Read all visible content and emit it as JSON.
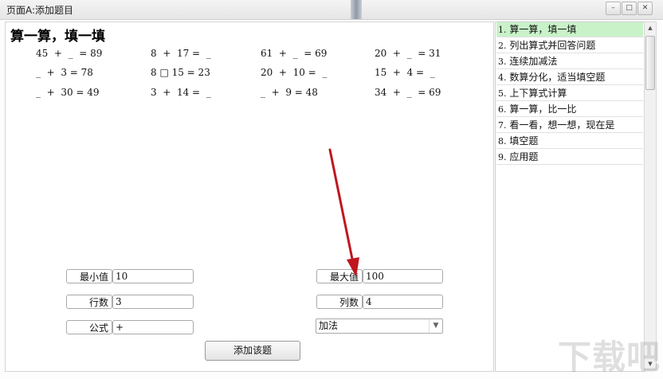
{
  "window": {
    "title": "页面A:添加题目",
    "controls": [
      "–",
      "□",
      "✕"
    ]
  },
  "main": {
    "heading": "算一算，填一填",
    "equations": [
      [
        "45  +  _  = 89",
        "8  +  17 =  _",
        "61  +  _  = 69",
        "20  +  _  = 31"
      ],
      [
        "_  +  3 = 78",
        "8 □ 15 = 23",
        "20  +  10 =  _",
        "15  +  4 =  _"
      ],
      [
        "_  +  30 = 49",
        "3  +  14 =  _",
        "_  +  9 = 48",
        "34  +  _  = 69"
      ]
    ]
  },
  "form": {
    "min_label": "最小值",
    "min_value": "10",
    "max_label": "最大值",
    "max_value": "100",
    "rows_label": "行数",
    "rows_value": "3",
    "cols_label": "列数",
    "cols_value": "4",
    "formula_label": "公式",
    "formula_value": "+",
    "operation_select": "加法",
    "add_button": "添加该题"
  },
  "sidebar": {
    "items": [
      {
        "num": "1.",
        "label": "算一算，填一填"
      },
      {
        "num": "2.",
        "label": "列出算式并回答问题"
      },
      {
        "num": "3.",
        "label": "连续加减法"
      },
      {
        "num": "4.",
        "label": "数算分化，适当填空题"
      },
      {
        "num": "5.",
        "label": "上下算式计算"
      },
      {
        "num": "6.",
        "label": "算一算，比一比"
      },
      {
        "num": "7.",
        "label": "看一看，想一想，现在是"
      },
      {
        "num": "8.",
        "label": "填空题"
      },
      {
        "num": "9.",
        "label": "应用题"
      }
    ],
    "selected_index": 0
  },
  "watermark": "下载吧",
  "colors": {
    "selected_bg": "#c9f2c9",
    "arrow": "#c0161e"
  }
}
